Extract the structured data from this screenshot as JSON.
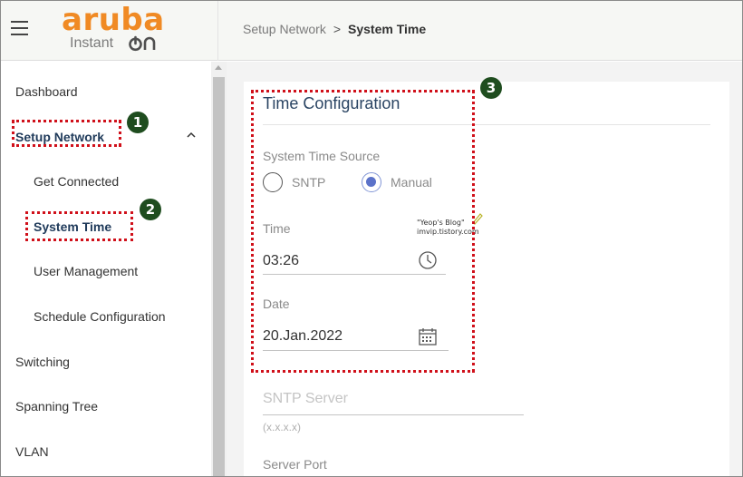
{
  "header": {
    "logo": {
      "wordmark": "aruba",
      "product": "Instant",
      "product_suffix": "On"
    },
    "breadcrumb": {
      "parent": "Setup Network",
      "separator": ">",
      "current": "System Time"
    }
  },
  "sidebar": {
    "items": [
      {
        "label": "Dashboard"
      },
      {
        "label": "Setup Network",
        "expanded": true,
        "active": true
      },
      {
        "label": "Get Connected"
      },
      {
        "label": "System Time",
        "active": true
      },
      {
        "label": "User Management"
      },
      {
        "label": "Schedule Configuration"
      },
      {
        "label": "Switching"
      },
      {
        "label": "Spanning Tree"
      },
      {
        "label": "VLAN"
      }
    ]
  },
  "card": {
    "title": "Time Configuration",
    "time_source": {
      "label": "System Time Source",
      "options": [
        {
          "label": "SNTP",
          "selected": false
        },
        {
          "label": "Manual",
          "selected": true
        }
      ]
    },
    "time": {
      "label": "Time",
      "value": "03:26",
      "icon": "clock-icon"
    },
    "date": {
      "label": "Date",
      "value": "20.Jan.2022",
      "icon": "calendar-icon"
    },
    "sntp_server": {
      "placeholder": "SNTP Server",
      "hint": "(x.x.x.x)"
    },
    "server_port": {
      "label": "Server Port"
    }
  },
  "watermark": {
    "line1": "\"Yeop's Blog\"",
    "line2": "imvip.tistory.com"
  },
  "annotations": {
    "step1": "1",
    "step2": "2",
    "step3": "3",
    "color": "#d0101a",
    "badge_color": "#1f4d1f"
  },
  "colors": {
    "logo": "#f08a24",
    "active_nav": "#1f3a5a",
    "radio_selected": "#5b72c9"
  }
}
